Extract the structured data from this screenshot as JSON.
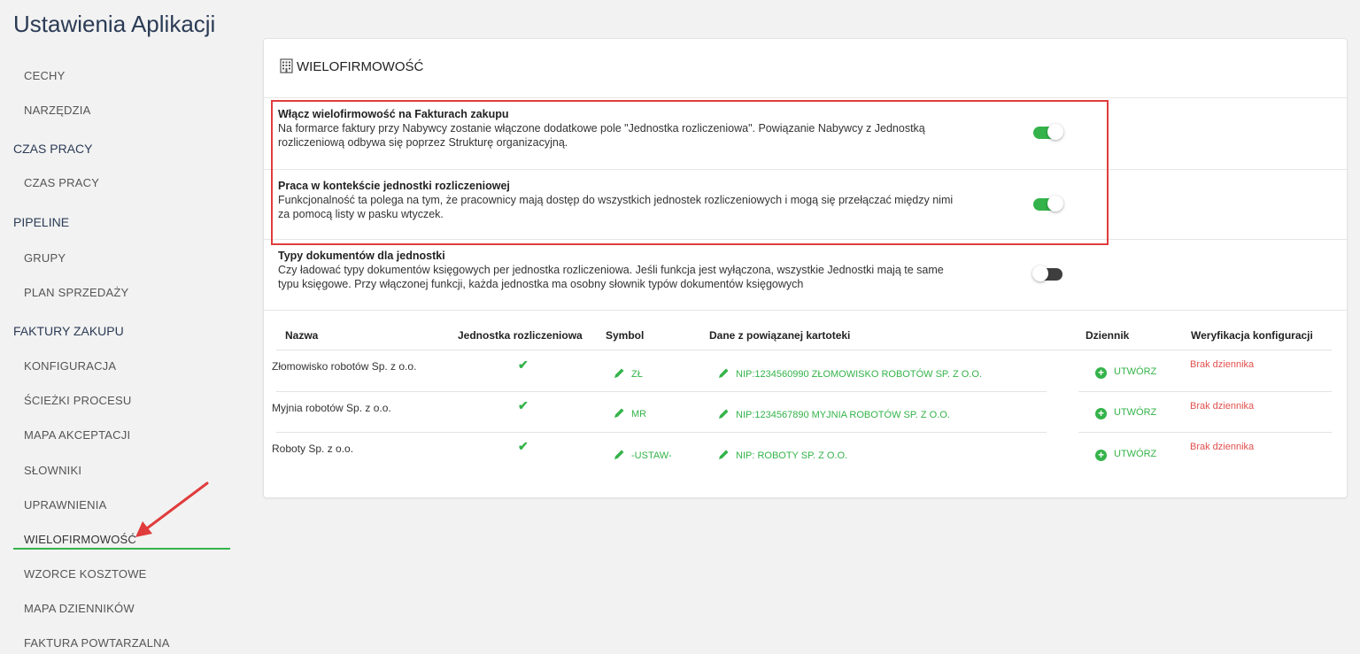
{
  "page": {
    "title": "Ustawienia Aplikacji"
  },
  "sidebar": {
    "items": [
      {
        "label": "CECHY",
        "type": "item"
      },
      {
        "label": "NARZĘDZIA",
        "type": "item"
      },
      {
        "label": "CZAS PRACY",
        "type": "section"
      },
      {
        "label": "CZAS PRACY",
        "type": "item"
      },
      {
        "label": "PIPELINE",
        "type": "section"
      },
      {
        "label": "GRUPY",
        "type": "item"
      },
      {
        "label": "PLAN SPRZEDAŻY",
        "type": "item"
      },
      {
        "label": "FAKTURY ZAKUPU",
        "type": "section"
      },
      {
        "label": "KONFIGURACJA",
        "type": "item"
      },
      {
        "label": "ŚCIEŻKI PROCESU",
        "type": "item"
      },
      {
        "label": "MAPA AKCEPTACJI",
        "type": "item"
      },
      {
        "label": "SŁOWNIKI",
        "type": "item"
      },
      {
        "label": "UPRAWNIENIA",
        "type": "item"
      },
      {
        "label": "WIELOFIRMOWOŚĆ",
        "type": "item",
        "active": true
      },
      {
        "label": "WZORCE KOSZTOWE",
        "type": "item"
      },
      {
        "label": "MAPA DZIENNIKÓW",
        "type": "item"
      },
      {
        "label": "FAKTURA POWTARZALNA",
        "type": "item"
      }
    ]
  },
  "card": {
    "title": "WIELOFIRMOWOŚĆ",
    "icon": "building-icon",
    "settings": [
      {
        "title": "Włącz wielofirmowość na Fakturach zakupu",
        "desc_line1": "Na formarce faktury przy Nabywcy zostanie włączone dodatkowe pole \"Jednostka rozliczeniowa\". Powiązanie Nabywcy z Jednostką",
        "desc_line2": "rozliczeniową odbywa się poprzez Strukturę organizacyjną.",
        "enabled": true
      },
      {
        "title": "Praca w kontekście jednostki rozliczeniowej",
        "desc_line1": "Funkcjonalność ta polega na tym, że pracownicy mają dostęp do wszystkich jednostek rozliczeniowych i mogą się przełączać między nimi",
        "desc_line2": "za pomocą listy w pasku wtyczek.",
        "enabled": true
      },
      {
        "title": "Typy dokumentów dla jednostki",
        "desc_line1": "Czy ładować typy dokumentów księgowych per jednostka rozliczeniowa. Jeśli funkcja jest wyłączona, wszystkie Jednostki mają te same",
        "desc_line2": "typu księgowe. Przy włączonej funkcji, każda jednostka ma osobny słownik typów dokumentów księgowych",
        "enabled": false
      }
    ]
  },
  "table": {
    "headers": {
      "name": "Nazwa",
      "unit": "Jednostka rozliczeniowa",
      "symbol": "Symbol",
      "data": "Dane z powiązanej kartoteki",
      "journal": "Dziennik",
      "verify": "Weryfikacja konfiguracji"
    },
    "rows": [
      {
        "name": "Złomowisko robotów Sp. z o.o.",
        "unit_check": "✔",
        "symbol": "ZŁ",
        "data": "NIP:1234560990 ZŁOMOWISKO ROBOTÓW SP. Z O.O.",
        "journal": "UTWÓRZ",
        "verify": "Brak dziennika"
      },
      {
        "name": "Myjnia robotów Sp. z o.o.",
        "unit_check": "✔",
        "symbol": "MR",
        "data": "NIP:1234567890 MYJNIA ROBOTÓW SP. Z O.O.",
        "journal": "UTWÓRZ",
        "verify": "Brak dziennika"
      },
      {
        "name": "Roboty Sp. z o.o.",
        "unit_check": "✔",
        "symbol": "-USTAW-",
        "data": "NIP: ROBOTY SP. Z O.O.",
        "journal": "UTWÓRZ",
        "verify": "Brak dziennika"
      }
    ]
  },
  "colors": {
    "accent": "#34b34a",
    "error": "#e0504d",
    "highlight": "#e03c3c",
    "title": "#2b3b55"
  }
}
